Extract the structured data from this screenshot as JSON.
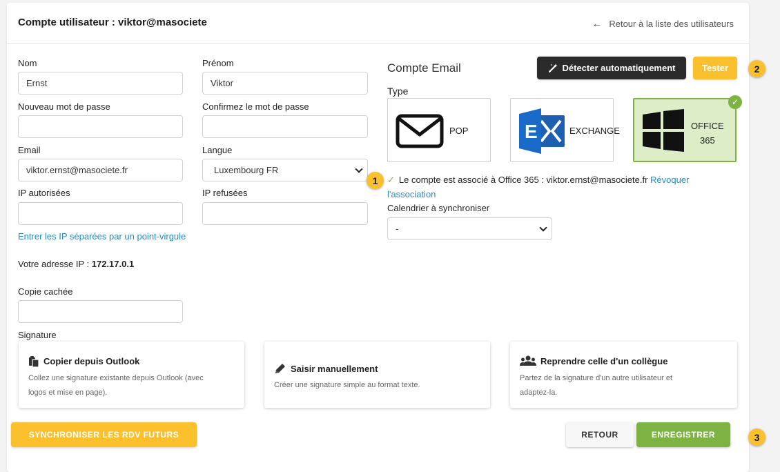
{
  "header": {
    "title": "Compte utilisateur : viktor@masociete",
    "back_label": "Retour à la liste des utilisateurs"
  },
  "form": {
    "nom": {
      "label": "Nom",
      "value": "Ernst"
    },
    "prenom": {
      "label": "Prénom",
      "value": "Viktor"
    },
    "new_password": {
      "label": "Nouveau mot de passe",
      "value": ""
    },
    "confirm_password": {
      "label": "Confirmez le mot de passe",
      "value": ""
    },
    "email": {
      "label": "Email",
      "value": "viktor.ernst@masociete.fr"
    },
    "langue": {
      "label": "Langue",
      "value": "Luxembourg FR"
    },
    "ip_allowed": {
      "label": "IP autorisées",
      "value": ""
    },
    "ip_refused": {
      "label": "IP refusées",
      "value": ""
    },
    "ip_hint": "Entrer les IP séparées par un point-virgule",
    "ip_address_label": "Votre adresse IP :",
    "ip_address_value": "172.17.0.1",
    "bcc": {
      "label": "Copie cachée",
      "value": ""
    },
    "signature_label": "Signature"
  },
  "email_account": {
    "title": "Compte Email",
    "detect_button": "Détecter automatiquement",
    "test_button": "Tester",
    "type_label": "Type",
    "types": {
      "pop": "POP",
      "exchange": "EXCHANGE",
      "office_line1": "OFFICE",
      "office_line2": "365"
    },
    "status_text": "Le compte est associé à Office 365 : viktor.ernst@masociete.fr",
    "revoke_link": "Révoquer l'association",
    "calendar_label": "Calendrier à synchroniser",
    "calendar_value": "-"
  },
  "signature_options": [
    {
      "title": "Copier depuis Outlook",
      "desc_line1": "Collez une signature existante depuis Outlook (avec",
      "desc_line2": "logos et mise en page).",
      "icon": "clipboard-icon"
    },
    {
      "title": "Saisir manuellement",
      "desc_line1": "Créer une signature simple au format texte.",
      "icon": "pencil-icon"
    },
    {
      "title": "Reprendre celle d'un collègue",
      "desc_line1": "Partez de la signature d'un autre utilisateur et",
      "desc_line2": "adaptez-la.",
      "icon": "users-icon"
    }
  ],
  "footer": {
    "sync_button": "SYNCHRONISER LES RDV FUTURS",
    "back_button": "RETOUR",
    "save_button": "ENREGISTRER"
  },
  "badges": {
    "one": "1",
    "two": "2",
    "three": "3"
  },
  "colors": {
    "accent_yellow": "#fbc02d",
    "success_green": "#7cb342",
    "link_blue": "#2a8bc4",
    "dark_button": "#2b2b2b"
  }
}
